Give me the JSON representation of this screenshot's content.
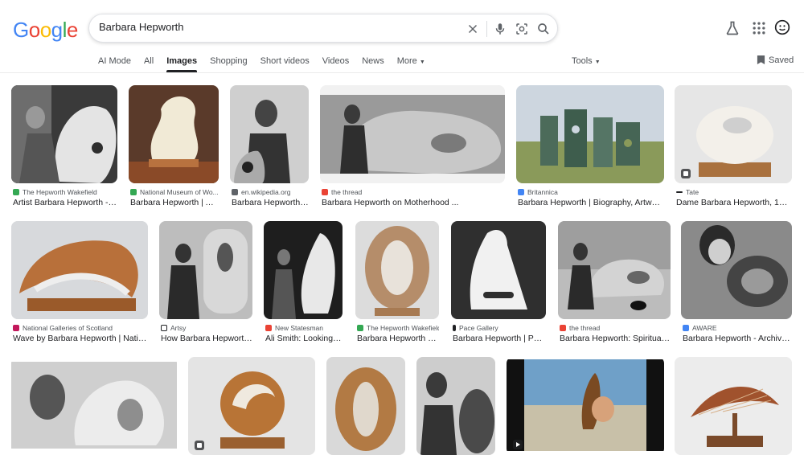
{
  "search": {
    "query": "Barbara Hepworth"
  },
  "tabs": [
    "AI Mode",
    "All",
    "Images",
    "Shopping",
    "Short videos",
    "Videos",
    "News",
    "More"
  ],
  "tools_label": "Tools",
  "saved_label": "Saved",
  "results": [
    {
      "source": "The Hepworth Wakefield",
      "title": "Artist Barbara Hepworth - The ...",
      "fav": "#34a853"
    },
    {
      "source": "National Museum of Wo...",
      "title": "Barbara Hepworth | Art...",
      "fav": "#34a853"
    },
    {
      "source": "en.wikipedia.org",
      "title": "Barbara Hepworth - ...",
      "fav": "#5f6368"
    },
    {
      "source": "the thread",
      "title": "Barbara Hepworth on Motherhood ...",
      "fav": "#ea4335"
    },
    {
      "source": "Britannica",
      "title": "Barbara Hepworth | Biography, Artwork ...",
      "fav": "#4285f4"
    },
    {
      "source": "Tate",
      "title": "Dame Barbara Hepworth, 1943 ...",
      "fav": "#202124"
    },
    {
      "source": "National Galleries of Scotland",
      "title": "Wave by Barbara Hepworth | Nation...",
      "fav": "#c2185b"
    },
    {
      "source": "Artsy",
      "title": "How Barbara Hepworth ...",
      "fav": "#202124"
    },
    {
      "source": "New Statesman",
      "title": "Ali Smith: Looking a...",
      "fav": "#ea4335"
    },
    {
      "source": "The Hepworth Wakefield",
      "title": "Barbara Hepworth - T...",
      "fav": "#34a853"
    },
    {
      "source": "Pace Gallery",
      "title": "Barbara Hepworth | Pac...",
      "fav": "#202124"
    },
    {
      "source": "the thread",
      "title": "Barbara Hepworth: Spiritual ...",
      "fav": "#ea4335"
    },
    {
      "source": "AWARE",
      "title": "Barbara Hepworth - Archives ...",
      "fav": "#4285f4"
    }
  ]
}
